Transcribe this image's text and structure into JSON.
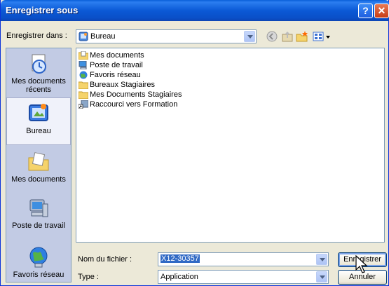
{
  "window": {
    "title": "Enregistrer sous",
    "help_glyph": "?",
    "close_glyph": "✕"
  },
  "save_in": {
    "label": "Enregistrer dans :",
    "value": "Bureau"
  },
  "toolbar": {
    "icons": [
      "back-icon",
      "up-folder-icon",
      "new-folder-icon",
      "view-menu-icon"
    ]
  },
  "places": [
    {
      "label": "Mes documents récents",
      "icon": "recent-documents-icon"
    },
    {
      "label": "Bureau",
      "icon": "desktop-icon",
      "selected": true
    },
    {
      "label": "Mes documents",
      "icon": "my-documents-icon"
    },
    {
      "label": "Poste de travail",
      "icon": "my-computer-icon"
    },
    {
      "label": "Favoris réseau",
      "icon": "network-places-icon"
    }
  ],
  "files": [
    {
      "name": "Mes documents",
      "icon": "my-documents-icon"
    },
    {
      "name": "Poste de travail",
      "icon": "my-computer-icon"
    },
    {
      "name": "Favoris réseau",
      "icon": "network-places-icon"
    },
    {
      "name": "Bureaux Stagiaires",
      "icon": "folder-icon"
    },
    {
      "name": "Mes Documents Stagiaires",
      "icon": "folder-icon"
    },
    {
      "name": "Raccourci vers Formation",
      "icon": "shortcut-icon"
    }
  ],
  "filename": {
    "label": "Nom du fichier :",
    "value": "X12-30357"
  },
  "filetype": {
    "label": "Type :",
    "value": "Application"
  },
  "buttons": {
    "save": "Enregistrer",
    "cancel": "Annuler"
  },
  "colors": {
    "titlebar": "#0a5fd8",
    "selection": "#316ac5",
    "dialog_bg": "#ece9d8",
    "places_bg": "#c2cbe4"
  }
}
